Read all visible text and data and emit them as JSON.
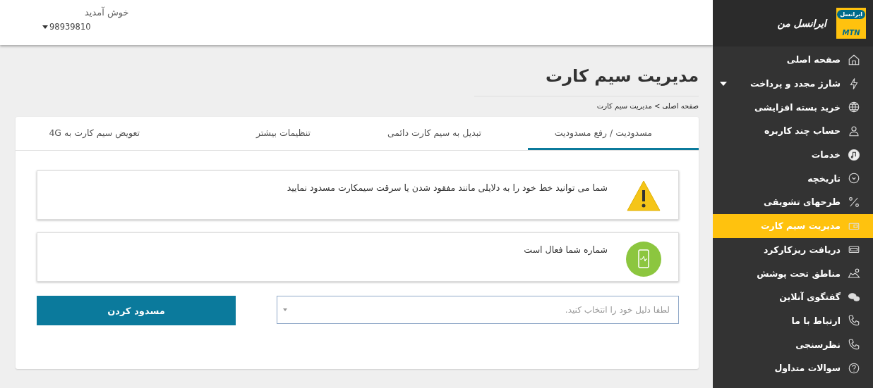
{
  "header": {
    "greeting": "خوش آمدید",
    "phone": "98939810"
  },
  "sidebar": {
    "logo": {
      "top": "ایرانسل",
      "bottom": "MTN"
    },
    "brand": "ایرانسل من",
    "items": [
      {
        "label": "صفحه اصلی",
        "selected": false,
        "has_submenu": false
      },
      {
        "label": "شارژ مجدد و پرداخت",
        "selected": false,
        "has_submenu": true
      },
      {
        "label": "خرید بسته افزایشی",
        "selected": false,
        "has_submenu": false
      },
      {
        "label": "حساب چند کاربره",
        "selected": false,
        "has_submenu": false
      },
      {
        "label": "خدمات",
        "selected": false,
        "has_submenu": false
      },
      {
        "label": "تاریخچه",
        "selected": false,
        "has_submenu": false
      },
      {
        "label": "طرحهای تشویقی",
        "selected": false,
        "has_submenu": false
      },
      {
        "label": "مدیریت سیم کارت",
        "selected": true,
        "has_submenu": false
      },
      {
        "label": "دریافت ریزکارکرد",
        "selected": false,
        "has_submenu": false
      },
      {
        "label": "مناطق تحت پوشش",
        "selected": false,
        "has_submenu": false
      },
      {
        "label": "گفتگوی آنلاین",
        "selected": false,
        "has_submenu": false
      },
      {
        "label": "ارتباط با ما",
        "selected": false,
        "has_submenu": false
      },
      {
        "label": "نظرسنجی",
        "selected": false,
        "has_submenu": false
      },
      {
        "label": "سوالات متداول",
        "selected": false,
        "has_submenu": false
      }
    ]
  },
  "page": {
    "title": "مدیریت سیم کارت",
    "breadcrumb": "صفحه اصلی > مدیریت سیم کارت"
  },
  "tabs": [
    {
      "label": "مسدودیت / رفع مسدودیت",
      "selected": true
    },
    {
      "label": "تبدیل به سیم کارت دائمی",
      "selected": false
    },
    {
      "label": "تنظیمات بیشتر",
      "selected": false
    },
    {
      "label": "تعویض سیم کارت به 4G",
      "selected": false
    }
  ],
  "alerts": [
    {
      "kind": "warning",
      "text": "شما می توانید خط خود را به دلایلی مانند مفقود شدن یا سرقت سیمکارت مسدود نمایید"
    },
    {
      "kind": "success",
      "text": "شماره شما فعال است"
    }
  ],
  "reason_select": {
    "placeholder": "لطفا دلیل خود را انتخاب کنید."
  },
  "block_button": "مسدود کردن"
}
